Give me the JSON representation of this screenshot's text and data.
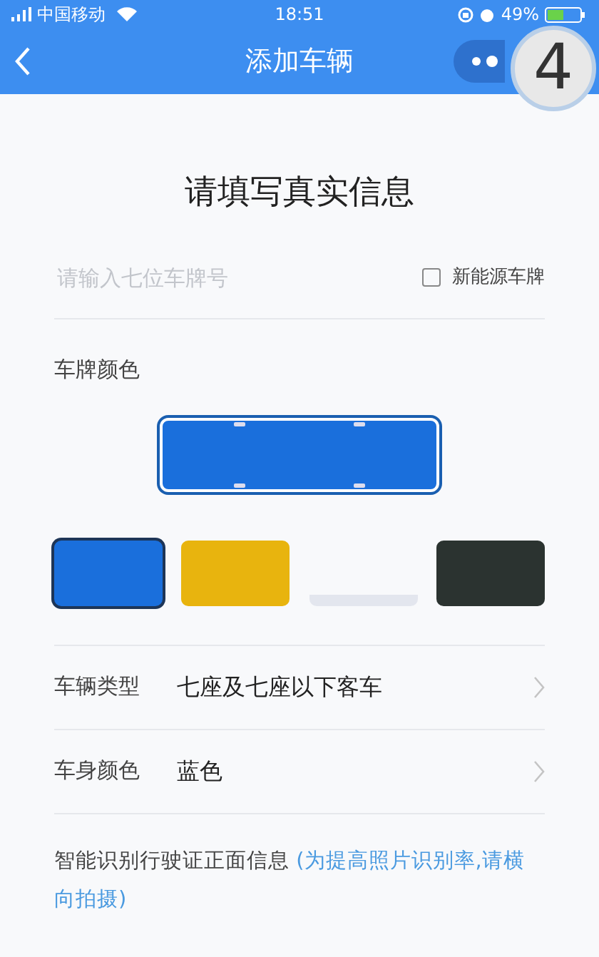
{
  "status_bar": {
    "carrier": "中国移动",
    "time": "18:51",
    "battery": "49%"
  },
  "nav": {
    "title": "添加车辆",
    "step_badge": "4"
  },
  "heading": "请填写真实信息",
  "plate_input": {
    "placeholder": "请输入七位车牌号"
  },
  "new_energy": {
    "label": "新能源车牌",
    "checked": false
  },
  "plate_color_label": "车牌颜色",
  "plate_colors": [
    {
      "color": "#1a6fdc",
      "kind": "plate",
      "selected": true
    },
    {
      "color": "#e8b40e",
      "kind": "plate",
      "selected": false
    },
    {
      "color": "#e3e6ee",
      "kind": "flat",
      "selected": false
    },
    {
      "color": "#2b3330",
      "kind": "plate",
      "selected": false
    }
  ],
  "fields": [
    {
      "label": "车辆类型",
      "value": "七座及七座以下客车"
    },
    {
      "label": "车身颜色",
      "value": "蓝色"
    }
  ],
  "note": {
    "text": "智能识别行驶证正面信息",
    "hint": "(为提高照片识别率,请横向拍摄)"
  }
}
